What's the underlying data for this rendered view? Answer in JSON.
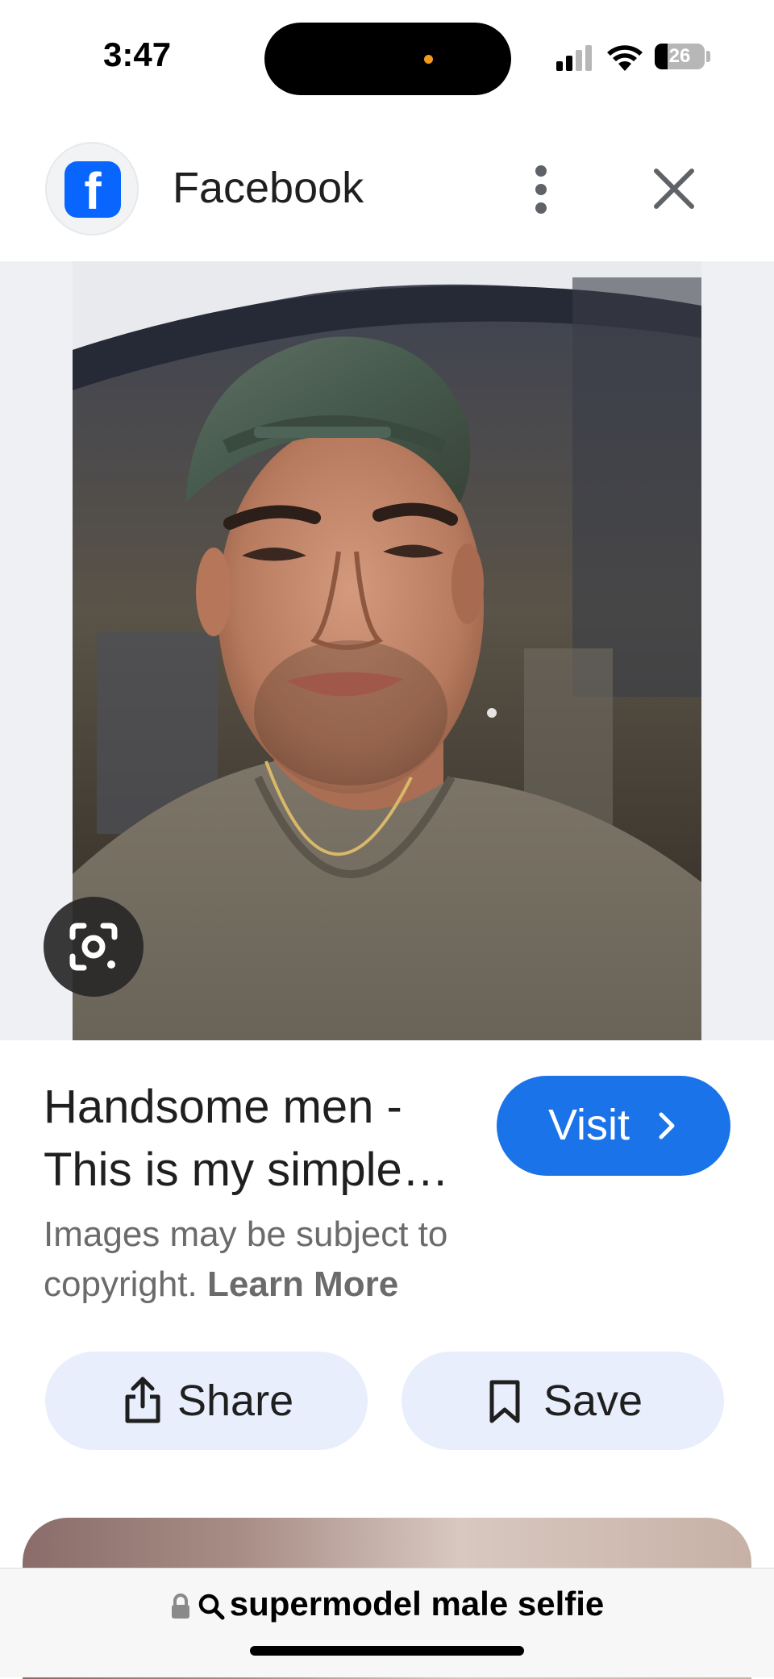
{
  "status": {
    "time": "3:47",
    "battery_level": "26",
    "battery_percent": 26
  },
  "header": {
    "site_name": "Facebook",
    "logo_letter": "f",
    "brand_color": "#0866ff"
  },
  "result": {
    "title": "Handsome men - This is my simple selfie",
    "visit_label": "Visit",
    "copyright_text": "Images may be subject to copyright.",
    "learn_more": "Learn More",
    "share_label": "Share",
    "save_label": "Save",
    "accent_color": "#1a73e8"
  },
  "address_bar": {
    "query": "supermodel male selfie"
  },
  "icons": [
    "facebook-logo-icon",
    "more-vertical-icon",
    "close-icon",
    "google-lens-icon",
    "chevron-right-icon",
    "share-icon",
    "bookmark-icon",
    "lock-icon",
    "search-icon"
  ]
}
